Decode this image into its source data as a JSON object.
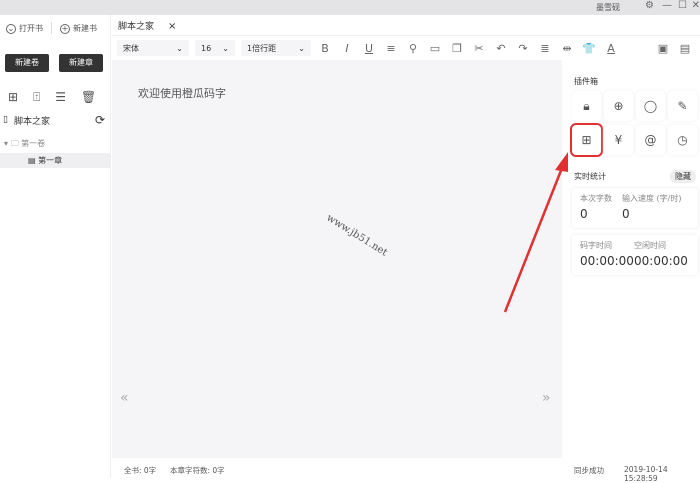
{
  "titlebar": {
    "brand": "墨雪砚"
  },
  "sidebar": {
    "open_book": "打开书",
    "new_book_top": "新建书",
    "new_volume": "新建卷",
    "new_chapter": "新建章",
    "book_name": "脚本之家",
    "volume": "第一卷",
    "chapter": "第一章"
  },
  "tabs": [
    {
      "label": "脚本之家"
    }
  ],
  "toolbar": {
    "font": "宋体",
    "size": "16",
    "line_spacing": "1倍行距"
  },
  "editor": {
    "welcome": "欢迎使用橙瓜码字",
    "watermark": "www.jb51.net"
  },
  "plugins": {
    "title": "插件箱",
    "highlighted_index": 4
  },
  "stats": {
    "title": "实时统计",
    "hide_label": "隐藏",
    "words_label": "本次字数",
    "words": "0",
    "speed_label": "输入速度 (字/时)",
    "speed": "0",
    "typing_time_label": "码字时间",
    "typing_time": "00:00:00",
    "idle_time_label": "空闲时间",
    "idle_time": "00:00:00"
  },
  "status": {
    "total": "全书: 0字",
    "chapter_chars": "本章字符数: 0字",
    "sync": "同步成功",
    "datetime": "2019-10-14 15:28:59"
  },
  "colors": {
    "highlight": "#e03030",
    "dark_button": "#333333"
  }
}
